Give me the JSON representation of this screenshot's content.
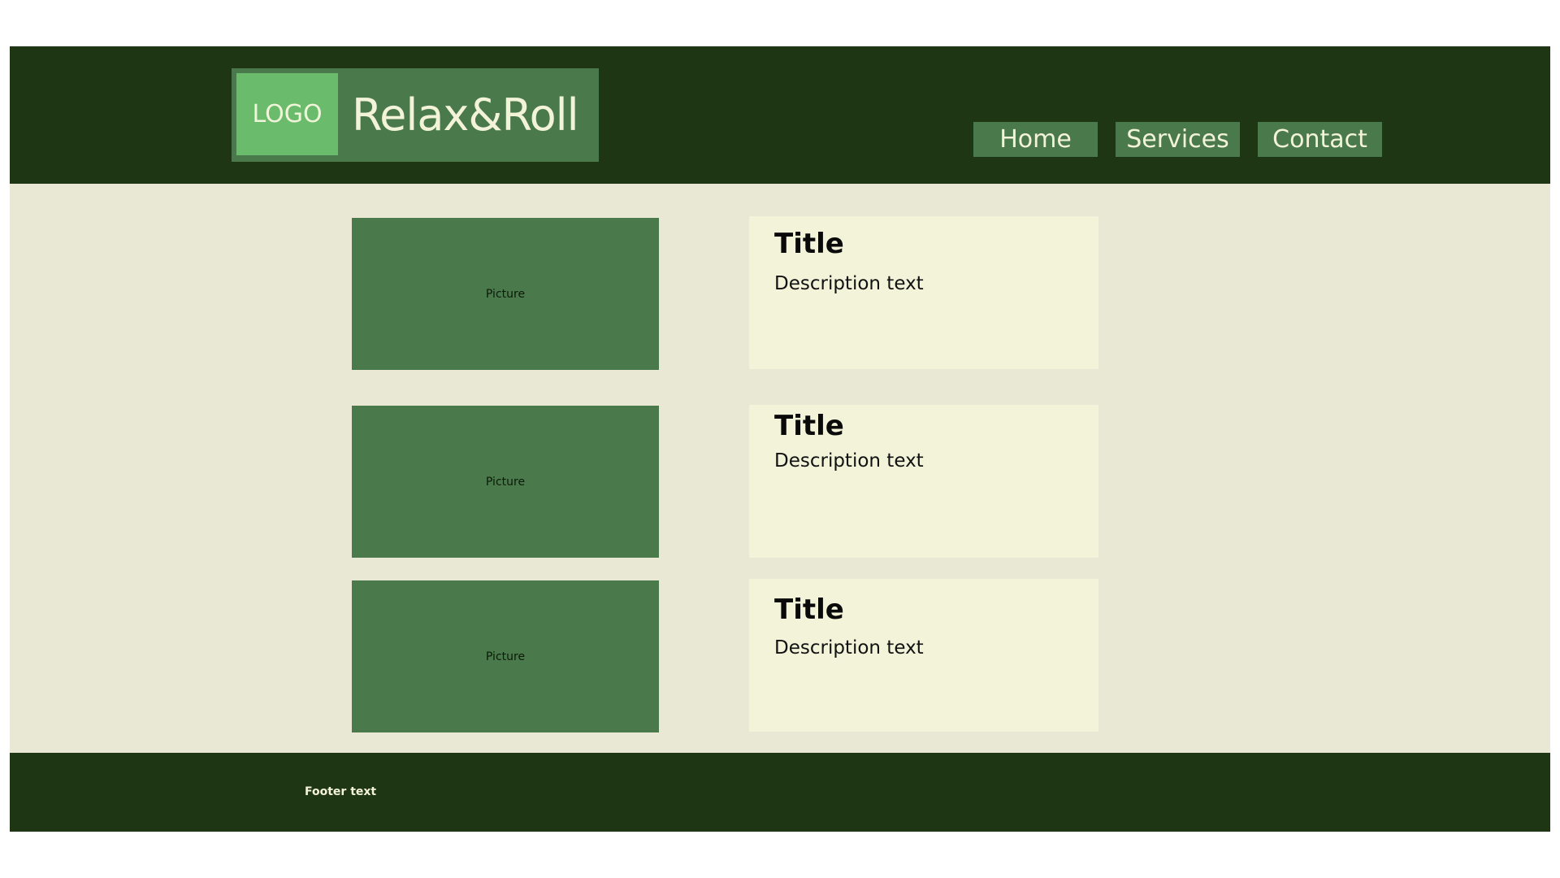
{
  "header": {
    "logo_text": "LOGO",
    "site_title": "Relax&Roll",
    "nav": [
      {
        "label": "Home"
      },
      {
        "label": "Services"
      },
      {
        "label": "Contact"
      }
    ]
  },
  "main": {
    "items": [
      {
        "picture_label": "Picture",
        "title": "Title",
        "description": "Description text"
      },
      {
        "picture_label": "Picture",
        "title": "Title",
        "description": "Description text"
      },
      {
        "picture_label": "Picture",
        "title": "Title",
        "description": "Description text"
      }
    ]
  },
  "footer": {
    "text": "Footer text"
  },
  "colors": {
    "header_bg": "#1e3614",
    "accent_green": "#4a7a4c",
    "logo_green": "#6abb6c",
    "content_bg": "#e9e8d5",
    "card_bg": "#f3f3d9"
  }
}
